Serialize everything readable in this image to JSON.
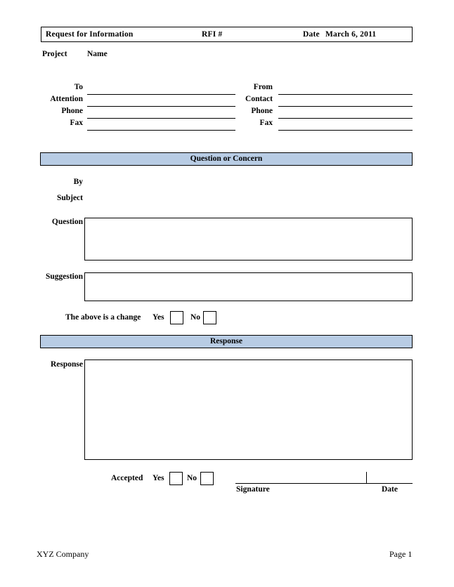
{
  "header": {
    "form_title": "Request for Information",
    "rfi_label": "RFI #",
    "date_label": "Date",
    "date_value": "March 6, 2011"
  },
  "project": {
    "label": "Project",
    "value": "Name"
  },
  "contacts": {
    "left": [
      {
        "label": "To"
      },
      {
        "label": "Attention"
      },
      {
        "label": "Phone"
      },
      {
        "label": "Fax"
      }
    ],
    "right": [
      {
        "label": "From"
      },
      {
        "label": "Contact"
      },
      {
        "label": "Phone"
      },
      {
        "label": "Fax"
      }
    ]
  },
  "question_section": {
    "bar_title": "Question or Concern",
    "by_label": "By",
    "subject_label": "Subject",
    "question_label": "Question",
    "suggestion_label": "Suggestion",
    "change_prompt": "The above is a change",
    "yes_label": "Yes",
    "no_label": "No"
  },
  "response_section": {
    "bar_title": "Response",
    "response_label": "Response",
    "accepted_label": "Accepted",
    "yes_label": "Yes",
    "no_label": "No",
    "signature_label": "Signature",
    "date_label": "Date"
  },
  "footer": {
    "company": "XYZ Company",
    "page": "Page 1"
  },
  "colors": {
    "section_bar_fill": "#b8cce4",
    "ink": "#000000",
    "paper": "#ffffff"
  }
}
